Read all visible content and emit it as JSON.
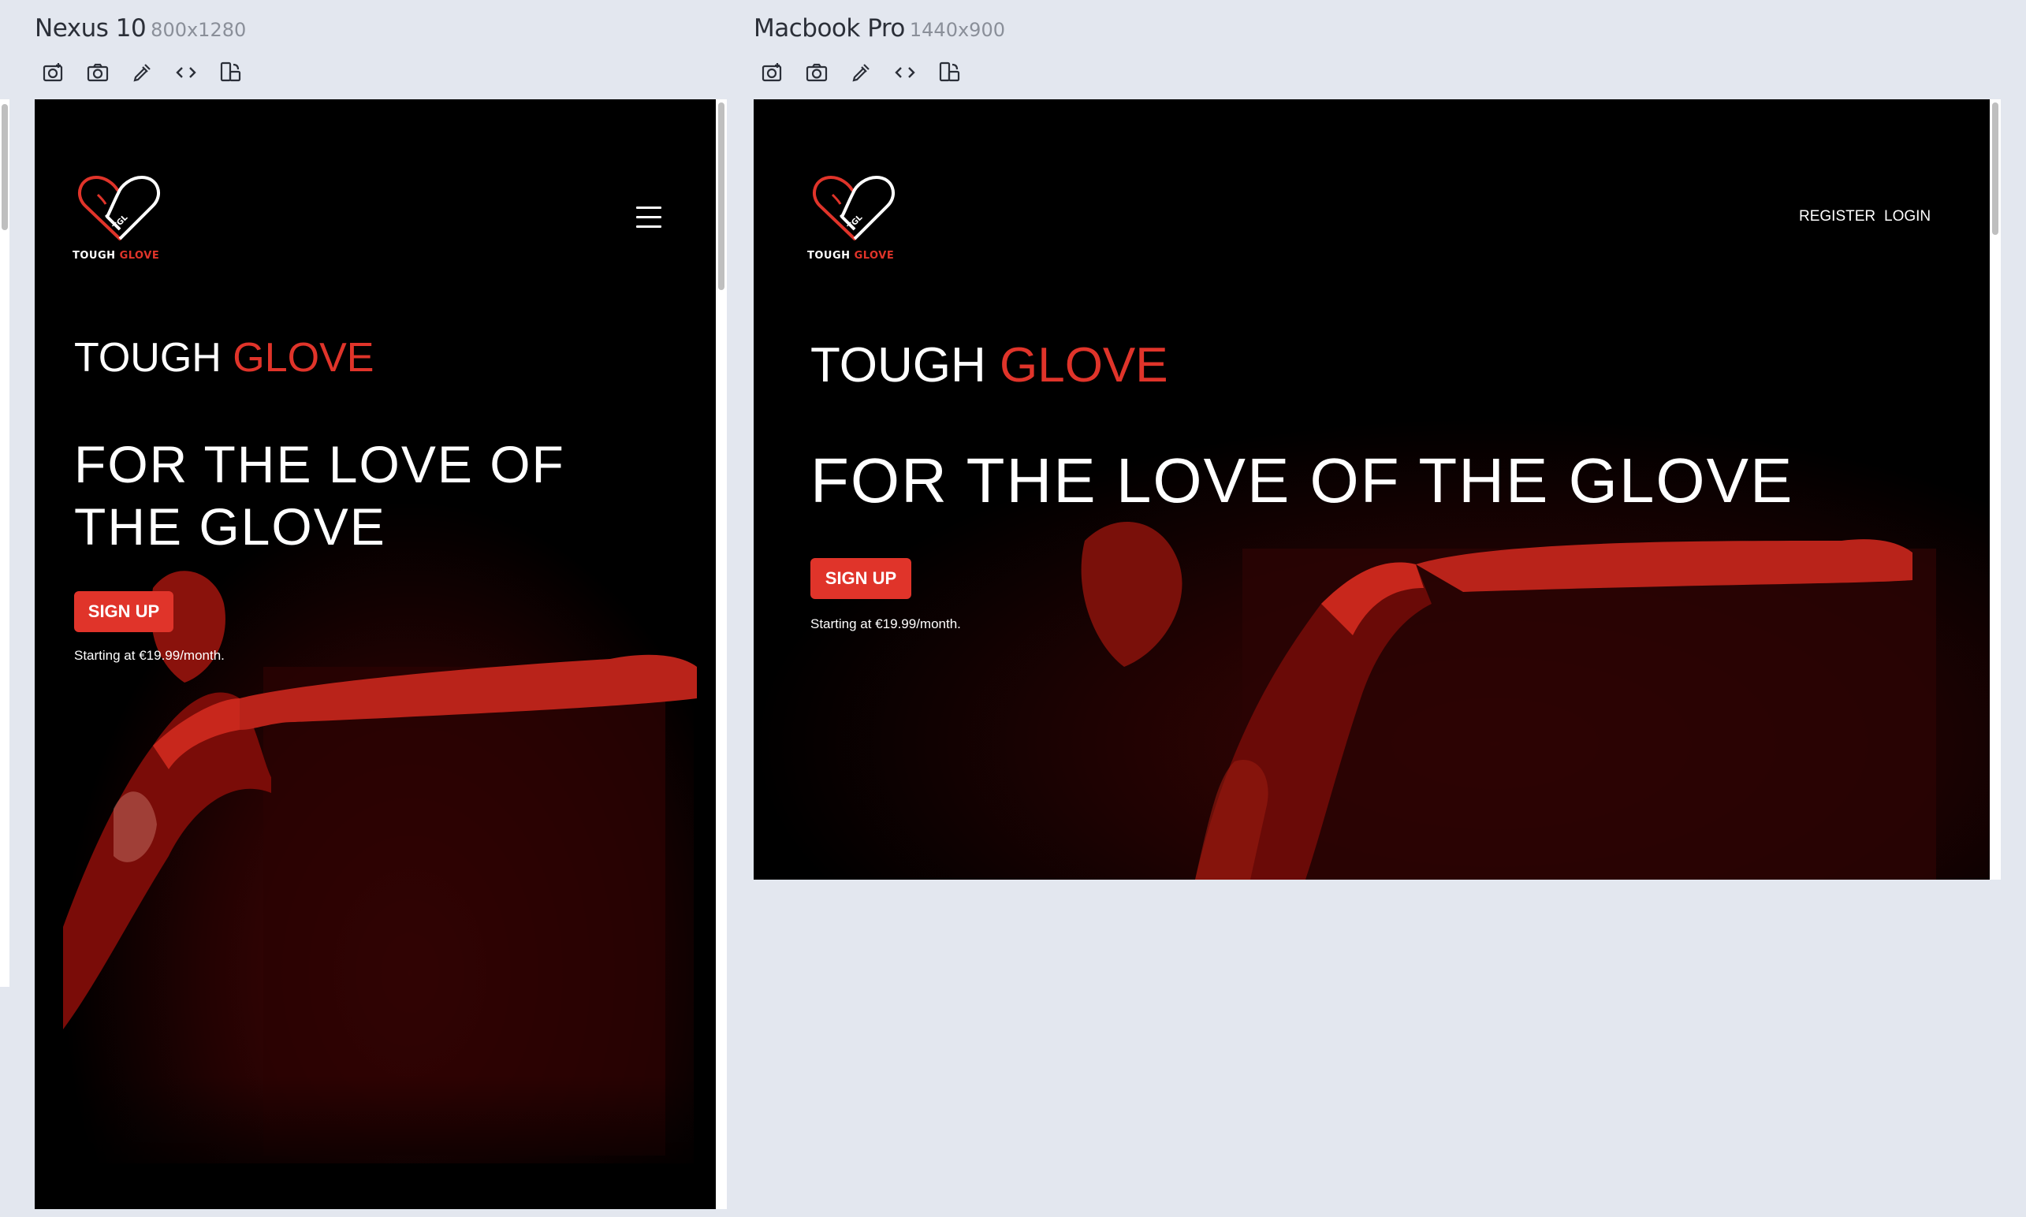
{
  "devices": [
    {
      "name": "Nexus 10",
      "resolution": "800x1280"
    },
    {
      "name": "Macbook Pro",
      "resolution": "1440x900"
    }
  ],
  "toolbar_icons": [
    "screenshot-full-icon",
    "camera-icon",
    "eyedropper-icon",
    "code-icon",
    "rotate-device-icon"
  ],
  "site": {
    "logo_word1": "TOUGH",
    "logo_word2": "GLOVE",
    "glove_text": "TGL",
    "brand_word1": "TOUGH",
    "brand_word2": "GLOVE",
    "tagline": "FOR THE LOVE OF THE GLOVE",
    "signup_label": "SIGN UP",
    "price_text": "Starting at €19.99/month.",
    "nav_register": "REGISTER",
    "nav_login": "LOGIN"
  },
  "colors": {
    "accent": "#e0342a",
    "background": "#000000",
    "page_bg": "#e3e7ef"
  }
}
